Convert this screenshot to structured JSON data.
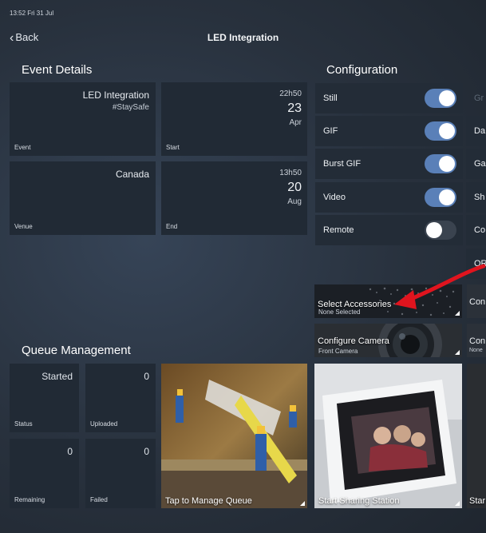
{
  "status_bar": {
    "time_date": "13:52  Fri 31 Jul"
  },
  "nav": {
    "back_label": "Back",
    "title": "LED Integration"
  },
  "event_details": {
    "title": "Event Details",
    "event": {
      "name": "LED Integration",
      "hashtag": "#StaySafe",
      "label": "Event"
    },
    "start": {
      "time": "22h50",
      "day": "23",
      "month": "Apr",
      "label": "Start"
    },
    "venue": {
      "name": "Canada",
      "label": "Venue"
    },
    "end": {
      "time": "13h50",
      "day": "20",
      "month": "Aug",
      "label": "End"
    }
  },
  "configuration": {
    "title": "Configuration",
    "toggles": [
      {
        "label": "Still",
        "on": true
      },
      {
        "label": "GIF",
        "on": true
      },
      {
        "label": "Burst GIF",
        "on": true
      },
      {
        "label": "Video",
        "on": true
      },
      {
        "label": "Remote",
        "on": false
      }
    ],
    "clipped_column": [
      "Gr",
      "Da",
      "Ga",
      "Sh",
      "Co",
      "QR",
      "Con",
      "Con",
      "None"
    ],
    "select_accessories": {
      "label": "Select Accessories",
      "sub": "None Selected"
    },
    "configure_camera": {
      "label": "Configure Camera",
      "sub": "Front Camera"
    }
  },
  "queue": {
    "title": "Queue Management",
    "status": {
      "value": "Started",
      "label": "Status"
    },
    "uploaded": {
      "value": "0",
      "label": "Uploaded"
    },
    "remaining": {
      "value": "0",
      "label": "Remaining"
    },
    "failed": {
      "value": "0",
      "label": "Failed"
    },
    "manage": "Tap to Manage Queue"
  },
  "sharing": {
    "label": "Start Sharing Station",
    "clipped": "Star"
  },
  "colors": {
    "toggle_on": "#5a80b8",
    "arrow": "#e0141e",
    "tile": "#212a35"
  }
}
